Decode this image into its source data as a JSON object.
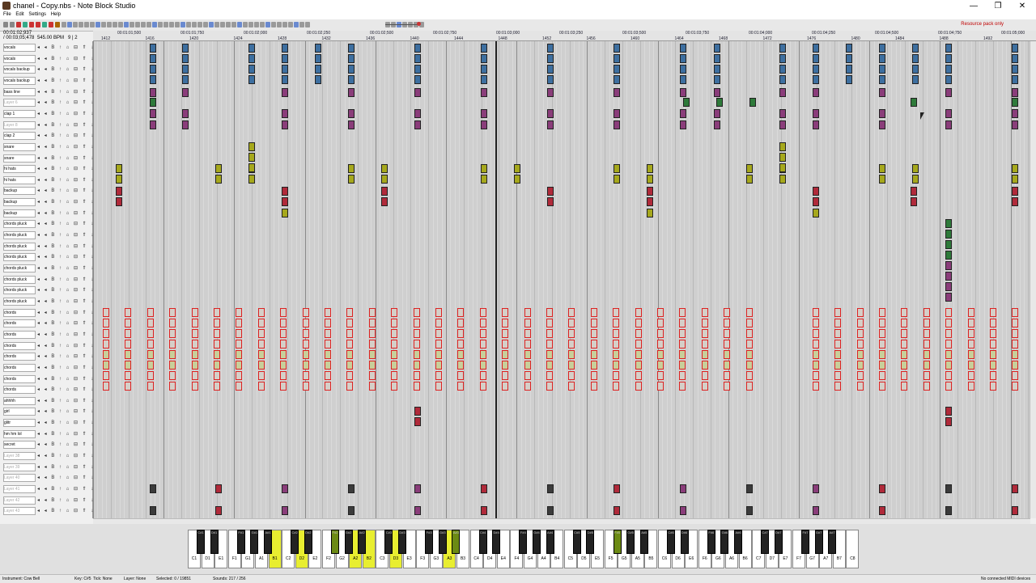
{
  "window": {
    "title": "chanel - Copy.nbs - Note Block Studio",
    "minimize": "—",
    "maximize": "❐",
    "close": "✕"
  },
  "menu": [
    "File",
    "Edit",
    "Settings",
    "Help"
  ],
  "toolbar": {
    "resource_pack": "Resource pack only"
  },
  "time": {
    "current": "00:01:02;937",
    "total": "/ 00:03;05;478",
    "tempo": "545.00 BPM",
    "tick_info": "9 | 2"
  },
  "ruler": {
    "times": [
      "00:01:01;500",
      "00:01:01;750",
      "00:01:02;000",
      "00:01:02;250",
      "00:01:02;500",
      "00:01:02;750",
      "00:01:03;000",
      "00:01:03;250",
      "00:01:03;500",
      "00:01:03;750",
      "00:01:04;000",
      "00:01:04;250",
      "00:01:04;500",
      "00:01:04;750",
      "00:01:05;000"
    ],
    "bars": [
      "1412",
      "1416",
      "1420",
      "1424",
      "1428",
      "1432",
      "1436",
      "1440",
      "1444",
      "1448",
      "1452",
      "1456",
      "1460",
      "1464",
      "1468",
      "1472",
      "1476",
      "1480",
      "1484",
      "1488",
      "1492"
    ]
  },
  "layers": [
    "vocals",
    "vocals",
    "vocals backup",
    "vocals backup",
    "bass line",
    "Layer 6",
    "clap 1",
    "Layer 8",
    "clap 2",
    "snare",
    "snare",
    "hi hats",
    "hi hats",
    "backup",
    "backup",
    "backup",
    "chords pluck",
    "chords pluck",
    "chords pluck",
    "chords pluck",
    "chords pluck",
    "chords pluck",
    "chords pluck",
    "chords pluck",
    "chords",
    "chords",
    "chords",
    "chords",
    "chords",
    "chords",
    "chords",
    "chords",
    "ahhhh",
    "girl",
    "glitr",
    "hm hm lol",
    "secret",
    "Layer 38",
    "Layer 39",
    "Layer 40",
    "Layer 41",
    "Layer 42",
    "Layer 43"
  ],
  "layer_controls": "◂ ◂ B ↑ ⌂ ⊟ ⇑ ↓",
  "piano": {
    "white_keys": [
      "C1",
      "D1",
      "E1",
      "F1",
      "G1",
      "A1",
      "B1",
      "C2",
      "D2",
      "E2",
      "F2",
      "G2",
      "A2",
      "B2",
      "C3",
      "D3",
      "E3",
      "F3",
      "G3",
      "A3",
      "B3",
      "C4",
      "D4",
      "E4",
      "F4",
      "G4",
      "A4",
      "B4",
      "C5",
      "D5",
      "E5",
      "F5",
      "G5",
      "A5",
      "B5",
      "C6",
      "D6",
      "E6",
      "F6",
      "G6",
      "A6",
      "B6",
      "C7",
      "D7",
      "E7",
      "F7",
      "G7",
      "A7",
      "B7",
      "C8"
    ],
    "black_keys": [
      "C#1",
      "D#1",
      "F#1",
      "G#1",
      "A#1",
      "C#2",
      "D#2",
      "F#2",
      "G#2",
      "A#2",
      "C#3",
      "D#3",
      "F#3",
      "G#3",
      "A#3",
      "C#4",
      "D#4",
      "F#4",
      "G#4",
      "A#4",
      "C#5",
      "D#5",
      "F#5",
      "G#5",
      "A#5",
      "C#6",
      "D#6",
      "F#6",
      "G#6",
      "A#6",
      "C#7",
      "D#7",
      "F#7",
      "G#7",
      "A#7"
    ],
    "pressed_white": [
      "B1",
      "D2",
      "A2",
      "B2",
      "D3",
      "A3"
    ],
    "pressed_black": [
      "F#2",
      "A#3",
      "F#5"
    ]
  },
  "status": {
    "instrument": "Instrument: Cow Bell",
    "key": "Key: C#5",
    "tick": "Tick: None",
    "layer": "Layer: None",
    "selected": "Selected: 0 / 19851",
    "sounds": "Sounds: 217 / 256",
    "midi": "No connected MIDI devices"
  },
  "colors": {
    "blue_note": "#3d6fa0",
    "purple_note": "#8a3d7a",
    "green_note": "#2e7a3a",
    "yellow_note": "#a6a81c",
    "red_note": "#b02a3a",
    "dark_note": "#3b3b3b",
    "playhead": "#222222",
    "key_pressed": "#e8ee30"
  }
}
